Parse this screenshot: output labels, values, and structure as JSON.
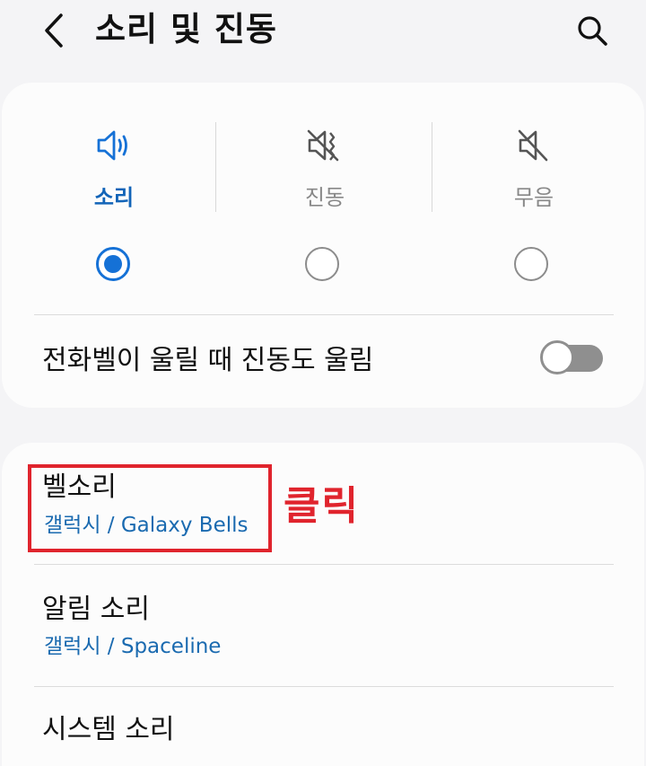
{
  "header": {
    "title": "소리 및 진동",
    "back_icon": "chevron-left-icon",
    "search_icon": "search-icon"
  },
  "sound_mode": {
    "options": [
      {
        "label": "소리",
        "icon": "speaker-sound-icon",
        "selected": true
      },
      {
        "label": "진동",
        "icon": "vibrate-icon",
        "selected": false
      },
      {
        "label": "무음",
        "icon": "mute-icon",
        "selected": false
      }
    ]
  },
  "vibrate_while_ringing": {
    "label": "전화벨이 울릴 때 진동도 울림",
    "enabled": false
  },
  "settings": [
    {
      "title": "벨소리",
      "subtitle": "갤럭시 / Galaxy Bells"
    },
    {
      "title": "알림 소리",
      "subtitle": "갤럭시 / Spaceline"
    },
    {
      "title": "시스템 소리",
      "subtitle": ""
    }
  ],
  "annotation": {
    "label": "클릭",
    "color": "#e0242d"
  },
  "colors": {
    "accent": "#1571d6",
    "subtitle": "#1a6ab0",
    "background": "#f4f4f6",
    "card": "#fcfcfc"
  }
}
